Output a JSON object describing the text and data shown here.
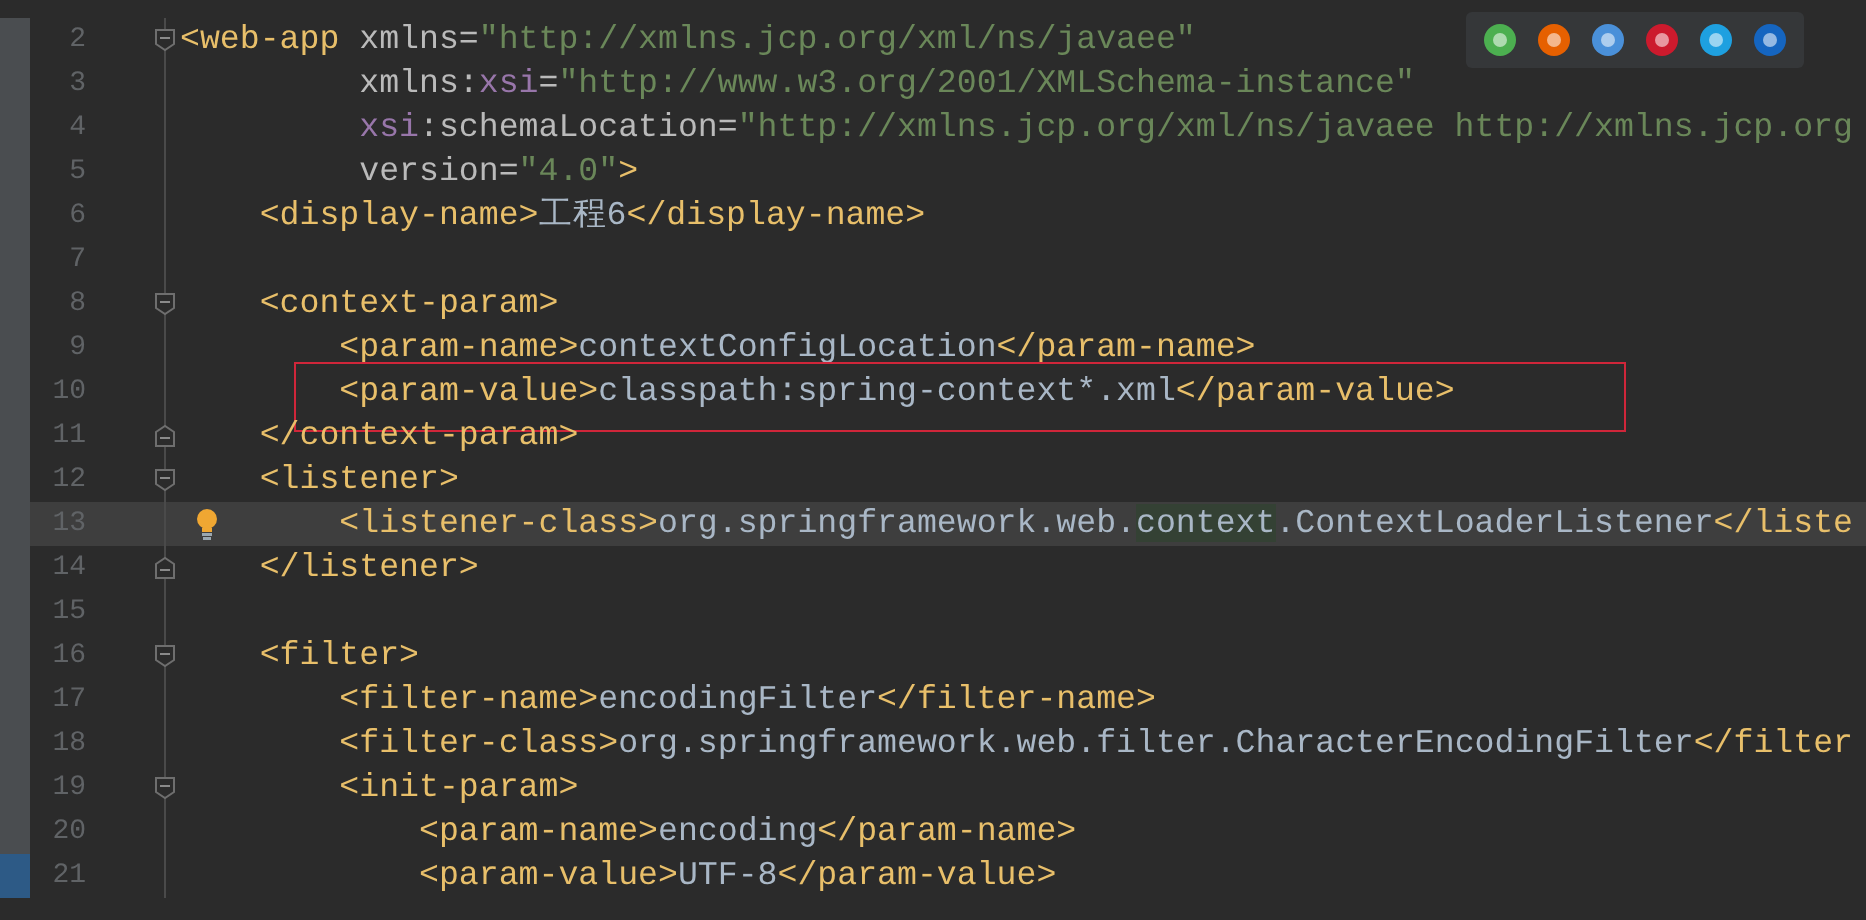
{
  "editor": {
    "lines": [
      {
        "number": "2",
        "current": false,
        "marked": false,
        "fold": {
          "kind": "start"
        },
        "tokens": [
          {
            "kind": "tag",
            "text": "<web-app"
          },
          {
            "kind": "attr",
            "text": " xmlns="
          },
          {
            "kind": "value",
            "text": "\"http://xmlns.jcp.org/xml/ns/javaee\""
          }
        ]
      },
      {
        "number": "3",
        "current": false,
        "marked": false,
        "tokens": [
          {
            "kind": "attr",
            "text": "         xmlns:"
          },
          {
            "kind": "ns",
            "text": "xsi"
          },
          {
            "kind": "attr",
            "text": "="
          },
          {
            "kind": "value",
            "text": "\"http://www.w3.org/2001/XMLSchema-instance\""
          }
        ]
      },
      {
        "number": "4",
        "current": false,
        "marked": false,
        "tokens": [
          {
            "kind": "ns",
            "text": "         xsi"
          },
          {
            "kind": "attr",
            "text": ":schemaLocation="
          },
          {
            "kind": "value",
            "text": "\"http://xmlns.jcp.org/xml/ns/javaee http://xmlns.jcp.org"
          }
        ]
      },
      {
        "number": "5",
        "current": false,
        "marked": false,
        "tokens": [
          {
            "kind": "attr",
            "text": "         version="
          },
          {
            "kind": "value",
            "text": "\"4.0\""
          },
          {
            "kind": "tag",
            "text": ">"
          }
        ]
      },
      {
        "number": "6",
        "current": false,
        "marked": false,
        "tokens": [
          {
            "kind": "tag",
            "text": "    <display-name>"
          },
          {
            "kind": "text",
            "text": "工程6"
          },
          {
            "kind": "tag",
            "text": "</display-name>"
          }
        ]
      },
      {
        "number": "7",
        "current": false,
        "marked": false
      },
      {
        "number": "8",
        "current": false,
        "marked": false,
        "fold": {
          "kind": "start"
        },
        "tokens": [
          {
            "kind": "tag",
            "text": "    <context-param>"
          }
        ]
      },
      {
        "number": "9",
        "current": false,
        "marked": false,
        "tokens": [
          {
            "kind": "tag",
            "text": "        <param-name>"
          },
          {
            "kind": "text",
            "text": "contextConfigLocation"
          },
          {
            "kind": "tag",
            "text": "</param-name>"
          }
        ]
      },
      {
        "number": "10",
        "current": false,
        "marked": false,
        "annotation": {
          "kind": "frame"
        },
        "tokens": [
          {
            "kind": "tag",
            "text": "        <param-value>"
          },
          {
            "kind": "text",
            "text": "classpath:spring-context*.xml"
          },
          {
            "kind": "tag",
            "text": "</param-value>"
          }
        ]
      },
      {
        "number": "11",
        "current": false,
        "marked": false,
        "fold": {
          "kind": "end"
        },
        "tokens": [
          {
            "kind": "tag",
            "text": "    </context-param>"
          }
        ]
      },
      {
        "number": "12",
        "current": false,
        "marked": false,
        "fold": {
          "kind": "start"
        },
        "tokens": [
          {
            "kind": "tag",
            "text": "    <listener>"
          }
        ]
      },
      {
        "number": "13",
        "current": true,
        "marked": false,
        "gutter_icon": {
          "kind": "bulb"
        },
        "tokens": [
          {
            "kind": "tag",
            "text": "        <listener-class>"
          },
          {
            "kind": "text",
            "text": "org.springframework.web."
          },
          {
            "kind": "match",
            "text": "context"
          },
          {
            "kind": "text",
            "text": ".ContextLoaderListener"
          },
          {
            "kind": "tag",
            "text": "</liste"
          }
        ]
      },
      {
        "number": "14",
        "current": false,
        "marked": false,
        "fold": {
          "kind": "end"
        },
        "tokens": [
          {
            "kind": "tag",
            "text": "    </listener>"
          }
        ]
      },
      {
        "number": "15",
        "current": false,
        "marked": false
      },
      {
        "number": "16",
        "current": false,
        "marked": false,
        "fold": {
          "kind": "start"
        },
        "tokens": [
          {
            "kind": "tag",
            "text": "    <filter>"
          }
        ]
      },
      {
        "number": "17",
        "current": false,
        "marked": false,
        "tokens": [
          {
            "kind": "tag",
            "text": "        <filter-name>"
          },
          {
            "kind": "text",
            "text": "encodingFilter"
          },
          {
            "kind": "tag",
            "text": "</filter-name>"
          }
        ]
      },
      {
        "number": "18",
        "current": false,
        "marked": false,
        "tokens": [
          {
            "kind": "tag",
            "text": "        <filter-class>"
          },
          {
            "kind": "text",
            "text": "org.springframework.web.filter.CharacterEncodingFilter"
          },
          {
            "kind": "tag",
            "text": "</filter"
          }
        ]
      },
      {
        "number": "19",
        "current": false,
        "marked": false,
        "fold": {
          "kind": "start"
        },
        "tokens": [
          {
            "kind": "tag",
            "text": "        <init-param>"
          }
        ]
      },
      {
        "number": "20",
        "current": false,
        "marked": false,
        "tokens": [
          {
            "kind": "tag",
            "text": "            <param-name>"
          },
          {
            "kind": "text",
            "text": "encoding"
          },
          {
            "kind": "tag",
            "text": "</param-name>"
          }
        ]
      },
      {
        "number": "21",
        "current": false,
        "marked": true,
        "tokens": [
          {
            "kind": "tag",
            "text": "            <param-value>"
          },
          {
            "kind": "text",
            "text": "UTF-8"
          },
          {
            "kind": "tag",
            "text": "</param-value>"
          }
        ]
      }
    ]
  },
  "browser_bar": {
    "browsers": [
      {
        "color": "#4caf50"
      },
      {
        "color": "#e66000"
      },
      {
        "color": "#4a90d9"
      },
      {
        "color": "#cc1a2d"
      },
      {
        "color": "#1ea0e0"
      },
      {
        "color": "#1565c0"
      }
    ]
  }
}
